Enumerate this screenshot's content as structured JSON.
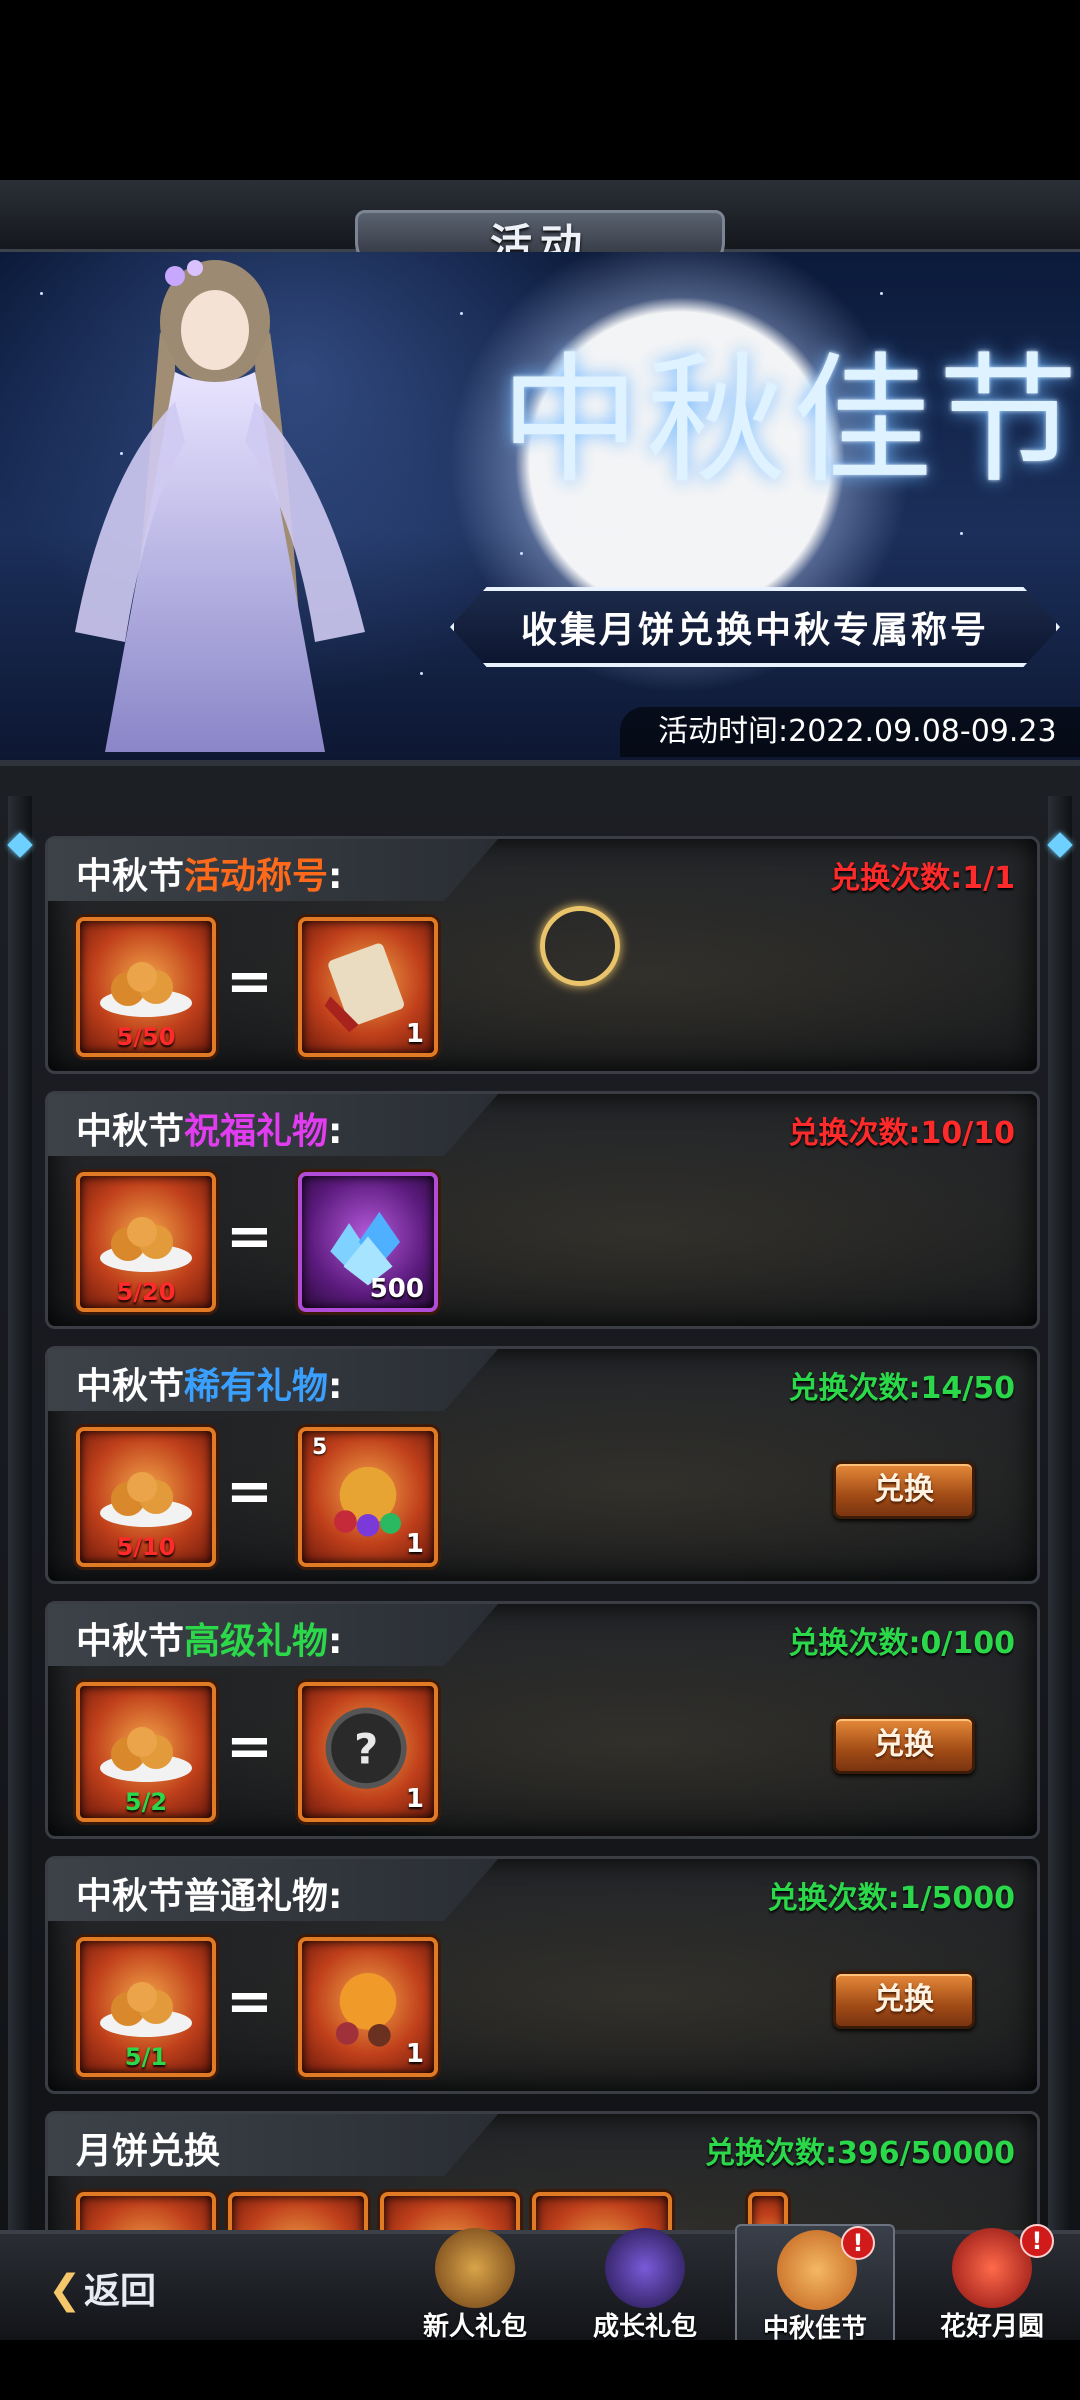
{
  "header": {
    "title": "活动"
  },
  "banner": {
    "festival_title": "中秋佳节",
    "subtitle": "收集月饼兑换中秋专属称号",
    "event_time": "活动时间:2022.09.08-09.23"
  },
  "colors": {
    "orange": "#ff6a1a",
    "magenta": "#e23cf0",
    "blue": "#3aa0ff",
    "green": "#2bd84a",
    "red": "#ff2a2a",
    "button": "#c56a26"
  },
  "cards": [
    {
      "prefix": "中秋节",
      "highlight": "活动称号",
      "suffix": ":",
      "highlight_color": "#ff6a1a",
      "count": "兑换次数:1/1",
      "count_color": "#ff2a2a",
      "cost": "5/50",
      "cost_color": "#ff2a2a",
      "reward_icon": "scroll-icon",
      "reward_qty": "1",
      "reward_frame": "orange",
      "has_button": false
    },
    {
      "prefix": "中秋节",
      "highlight": "祝福礼物",
      "suffix": ":",
      "highlight_color": "#e23cf0",
      "count": "兑换次数:10/10",
      "count_color": "#ff2a2a",
      "cost": "5/20",
      "cost_color": "#ff2a2a",
      "reward_icon": "diamond-pile-icon",
      "reward_qty": "500",
      "reward_frame": "purple",
      "has_button": false
    },
    {
      "prefix": "中秋节",
      "highlight": "稀有礼物",
      "suffix": ":",
      "highlight_color": "#3aa0ff",
      "count": "兑换次数:14/50",
      "count_color": "#2bd84a",
      "cost": "5/10",
      "cost_color": "#ff2a2a",
      "reward_icon": "gift-bag-icon",
      "reward_qty": "1",
      "reward_badge": "5",
      "reward_frame": "orange",
      "has_button": true
    },
    {
      "prefix": "中秋节",
      "highlight": "高级礼物",
      "suffix": ":",
      "highlight_color": "#2bd84a",
      "count": "兑换次数:0/100",
      "count_color": "#2bd84a",
      "cost": "5/2",
      "cost_color": "#2bd84a",
      "reward_icon": "mystery-orb-icon",
      "reward_qty": "1",
      "reward_frame": "orange",
      "has_button": true
    },
    {
      "prefix": "中秋节普通礼物",
      "highlight": "",
      "suffix": ":",
      "highlight_color": "#ffffff",
      "count": "兑换次数:1/5000",
      "count_color": "#2bd84a",
      "cost": "5/1",
      "cost_color": "#2bd84a",
      "reward_icon": "pumpkin-bag-icon",
      "reward_qty": "1",
      "reward_frame": "orange",
      "has_button": true
    }
  ],
  "last_card": {
    "title": "月饼兑换",
    "count": "兑换次数:396/50000",
    "count_color": "#2bd84a"
  },
  "redeem_label": "兑换",
  "nav": {
    "back": "返回",
    "tabs": [
      {
        "label": "新人礼包",
        "icon": "treasure-chest-icon",
        "badge": ""
      },
      {
        "label": "成长礼包",
        "icon": "mage-icon",
        "badge": ""
      },
      {
        "label": "中秋佳节",
        "icon": "mooncake-icon",
        "badge": "!"
      },
      {
        "label": "花好月圆",
        "icon": "lantern-icon",
        "badge": "!"
      }
    ]
  }
}
